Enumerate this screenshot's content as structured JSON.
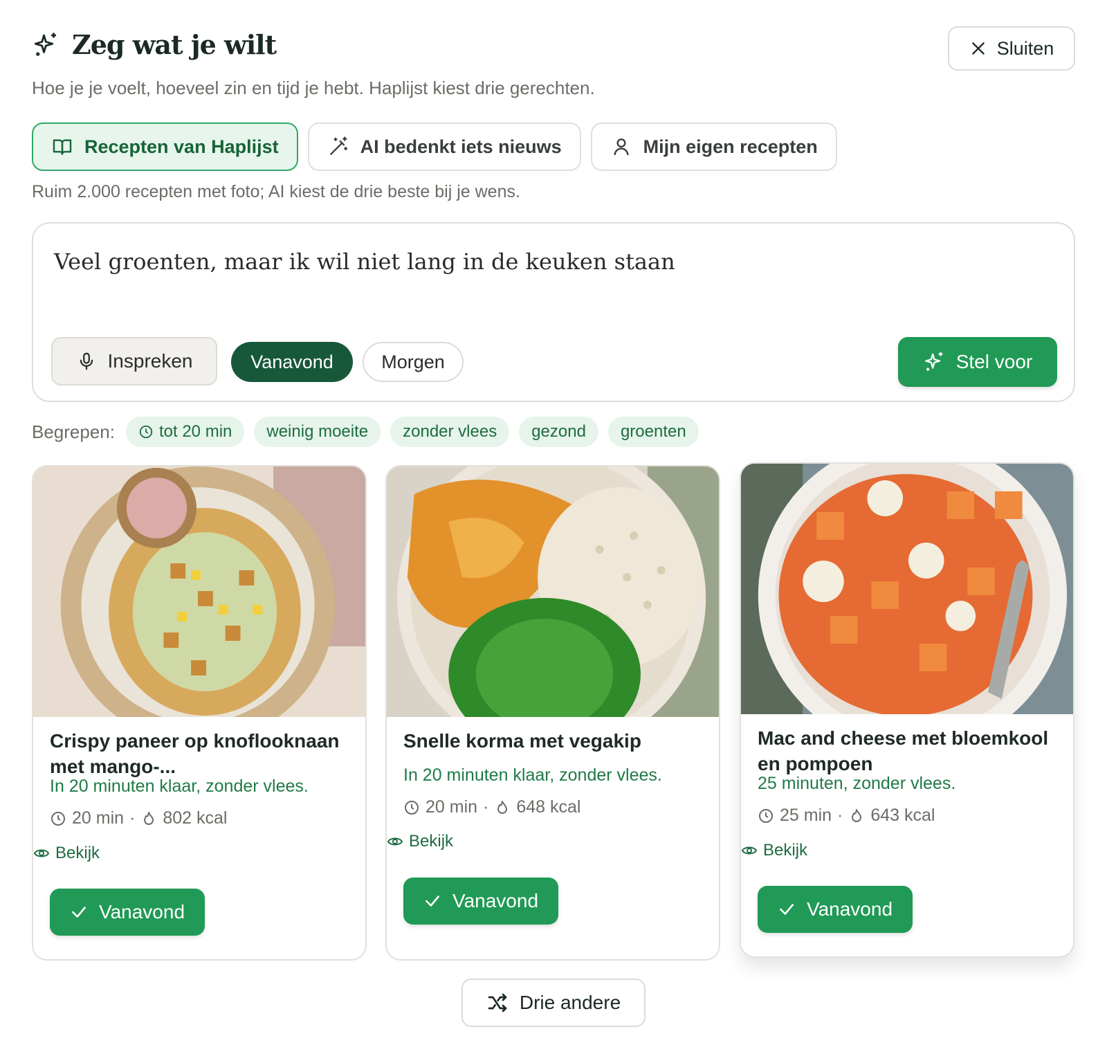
{
  "header": {
    "title": "Zeg wat je wilt",
    "subtitle": "Hoe je je voelt, hoeveel zin en tijd je hebt. Haplijst kiest drie gerechten.",
    "close_label": "Sluiten",
    "icon": "sparkle-icon"
  },
  "tabs": [
    {
      "label": "Recepten van Haplijst",
      "icon": "book-icon",
      "active": true
    },
    {
      "label": "AI bedenkt iets nieuws",
      "icon": "magic-wand-icon",
      "active": false
    },
    {
      "label": "Mijn eigen recepten",
      "icon": "user-icon",
      "active": false
    }
  ],
  "hint": "Ruim 2.000 recepten met foto; AI kiest de drie beste bij je wens.",
  "prompt": {
    "text": "Veel groenten, maar ik wil niet lang in de keuken staan",
    "mic_label": "Inspreken",
    "when_options": [
      "Vanavond",
      "Morgen"
    ],
    "when_selected": "Vanavond",
    "submit_label": "Stel voor"
  },
  "understood": {
    "label": "Begrepen:",
    "chips": [
      "tot 20 min",
      "weinig moeite",
      "zonder vlees",
      "gezond",
      "groenten"
    ]
  },
  "cards": [
    {
      "title": "Crispy paneer op knoflooknaan met mango-...",
      "note": "In 20 minuten klaar, zonder vlees.",
      "time": "20 min",
      "kcal": "802 kcal",
      "view_label": "Bekijk",
      "action_label": "Vanavond"
    },
    {
      "title": "Snelle korma met vegakip",
      "note": "In 20 minuten klaar, zonder vlees.",
      "time": "20 min",
      "kcal": "648 kcal",
      "view_label": "Bekijk",
      "action_label": "Vanavond"
    },
    {
      "title": "Mac and cheese met bloemkool en pompoen",
      "note": "25 minuten, zonder vlees.",
      "time": "25 min",
      "kcal": "643 kcal",
      "view_label": "Bekijk",
      "action_label": "Vanavond"
    }
  ],
  "shuffle_label": "Drie andere",
  "colors": {
    "accent": "#209a56",
    "accent_dark": "#17583a",
    "chip_bg": "#e6f4eb",
    "tab_active_bg": "#e7f5ec"
  }
}
